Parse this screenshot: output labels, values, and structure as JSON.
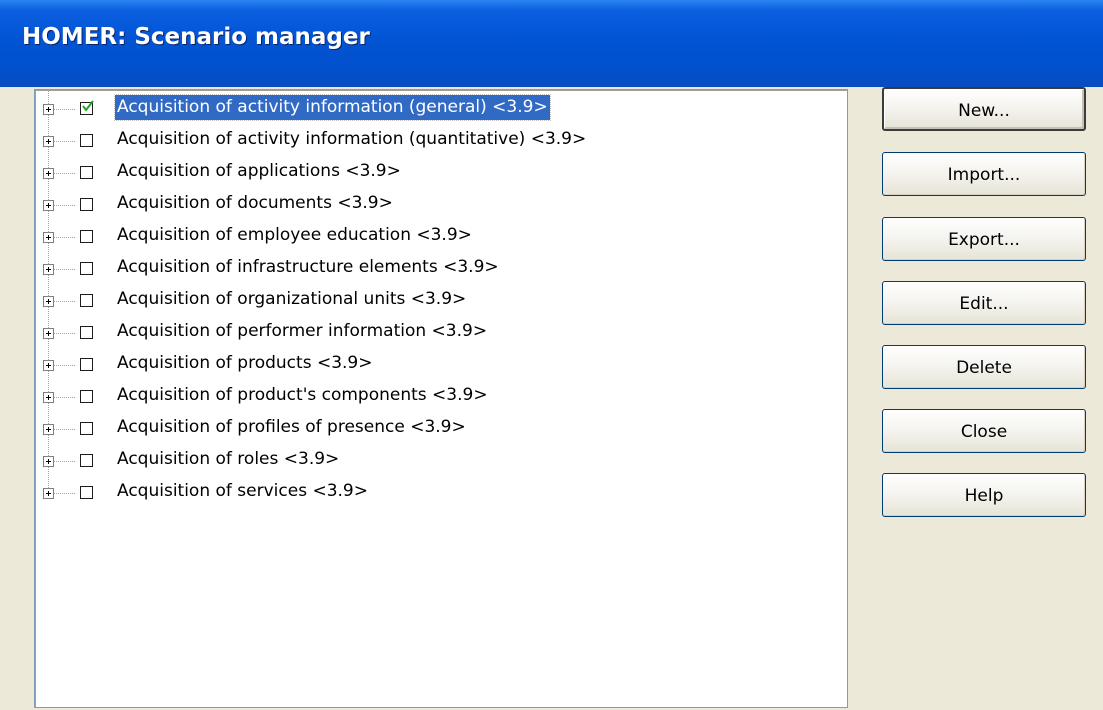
{
  "window": {
    "title": "HOMER: Scenario manager"
  },
  "tree": {
    "items": [
      {
        "label": "Acquisition of activity information (general) <3.9>",
        "checked": true,
        "selected": true
      },
      {
        "label": "Acquisition of activity information (quantitative) <3.9>",
        "checked": false,
        "selected": false
      },
      {
        "label": "Acquisition of applications <3.9>",
        "checked": false,
        "selected": false
      },
      {
        "label": "Acquisition of documents <3.9>",
        "checked": false,
        "selected": false
      },
      {
        "label": "Acquisition of employee education <3.9>",
        "checked": false,
        "selected": false
      },
      {
        "label": "Acquisition of infrastructure elements <3.9>",
        "checked": false,
        "selected": false
      },
      {
        "label": "Acquisition of organizational units <3.9>",
        "checked": false,
        "selected": false
      },
      {
        "label": "Acquisition of performer information <3.9>",
        "checked": false,
        "selected": false
      },
      {
        "label": "Acquisition of products <3.9>",
        "checked": false,
        "selected": false
      },
      {
        "label": "Acquisition of product's components <3.9>",
        "checked": false,
        "selected": false
      },
      {
        "label": "Acquisition of profiles of presence <3.9>",
        "checked": false,
        "selected": false
      },
      {
        "label": "Acquisition of roles <3.9>",
        "checked": false,
        "selected": false
      },
      {
        "label": "Acquisition of services <3.9>",
        "checked": false,
        "selected": false
      }
    ]
  },
  "buttons": {
    "new": "New...",
    "import": "Import...",
    "export": "Export...",
    "edit": "Edit...",
    "delete": "Delete",
    "close": "Close",
    "help": "Help"
  },
  "colors": {
    "titlebar": "#0254d4",
    "selection": "#316ac5",
    "checkmark": "#21a121"
  }
}
